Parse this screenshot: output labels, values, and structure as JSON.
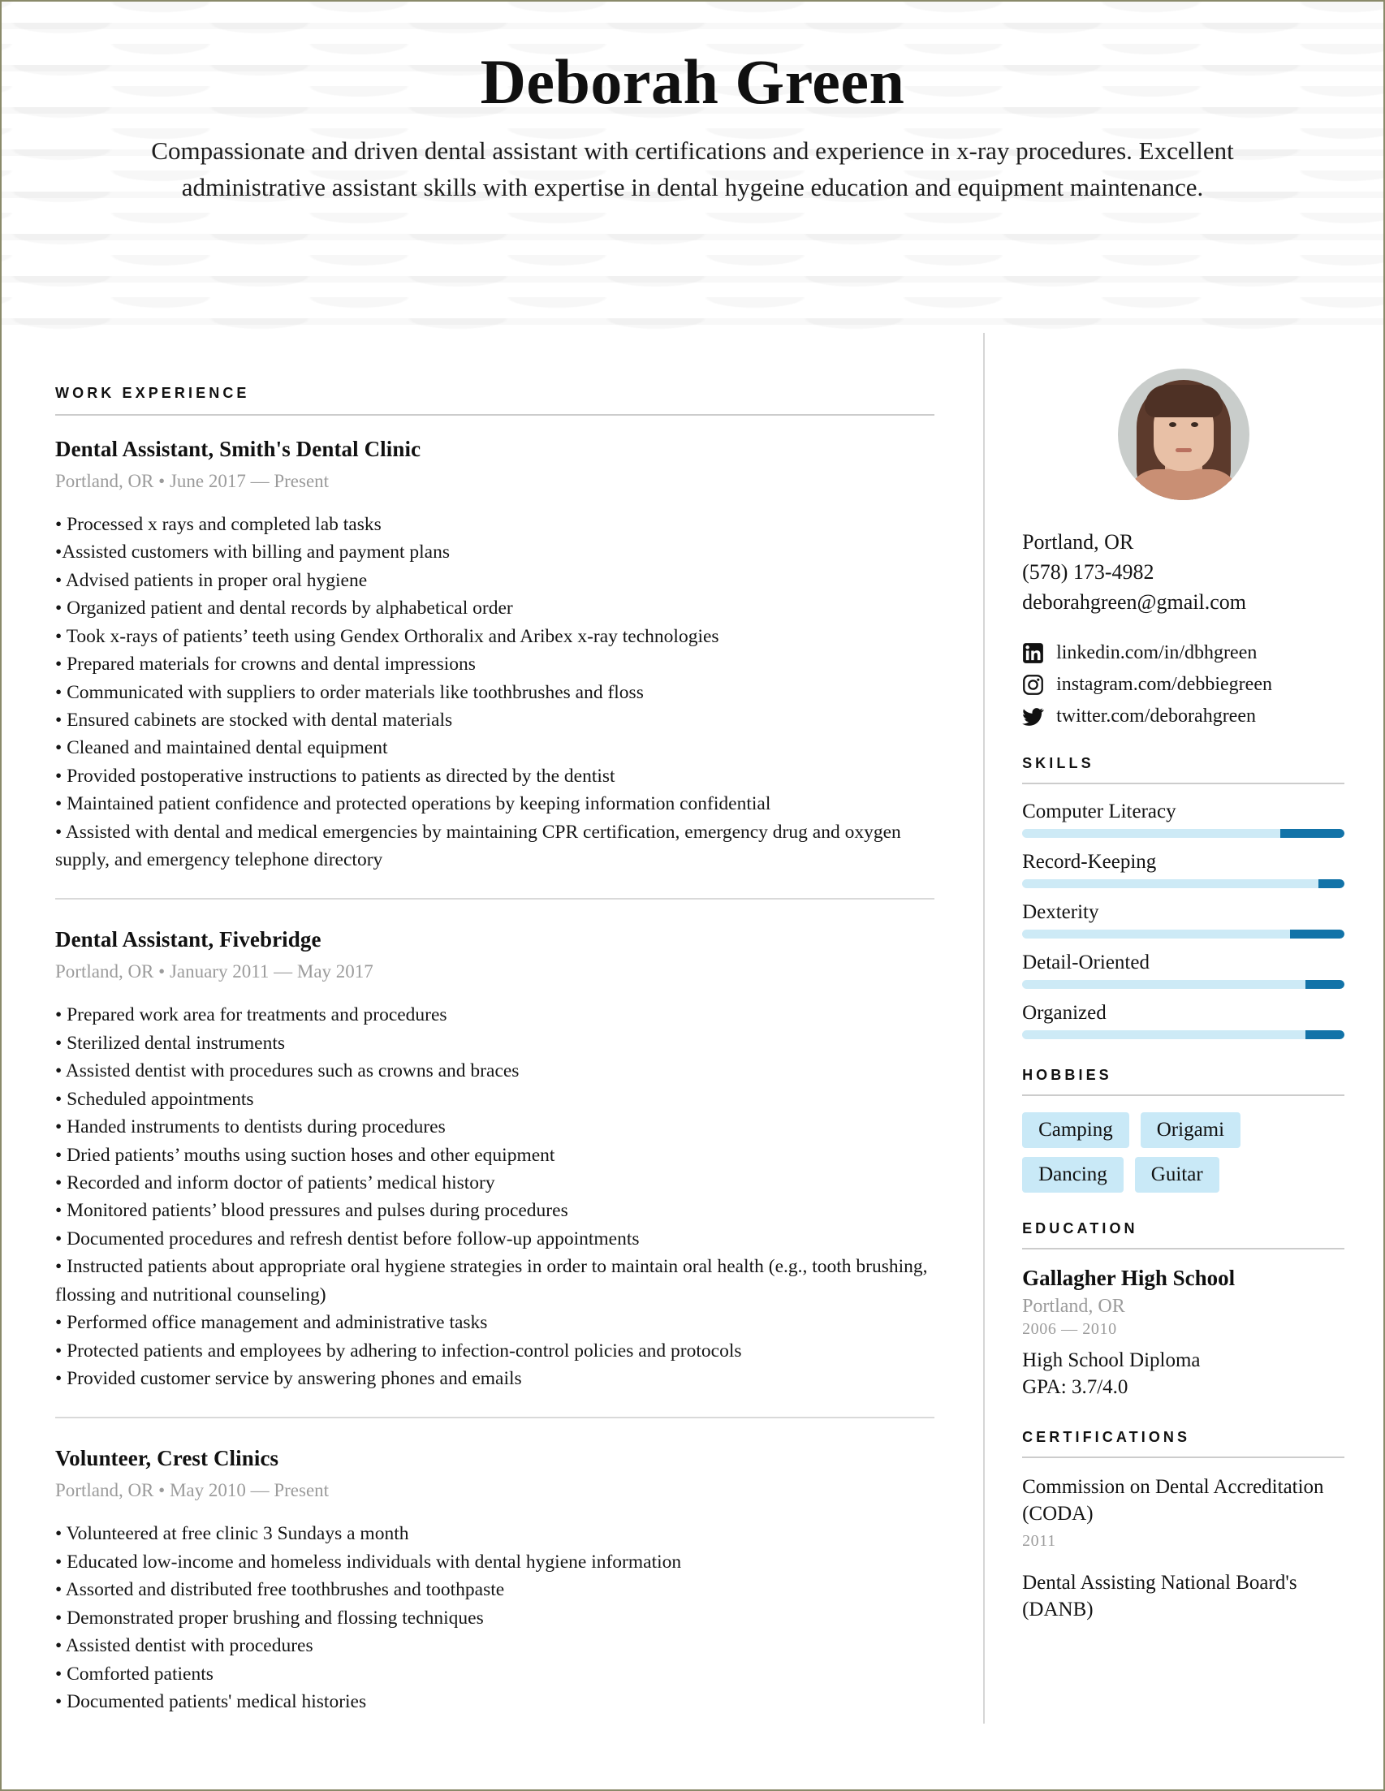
{
  "header": {
    "name": "Deborah Green",
    "summary": "Compassionate and driven dental assistant with certifications and experience in x-ray procedures. Excellent administrative assistant skills with expertise in dental hygeine education and equipment maintenance."
  },
  "work": {
    "heading": "WORK EXPERIENCE",
    "jobs": [
      {
        "title": "Dental Assistant, Smith's Dental Clinic",
        "meta": "Portland, OR • June 2017 — Present",
        "bullets": [
          "• Processed x rays and completed lab tasks",
          "•Assisted customers with billing and payment plans",
          "• Advised patients in proper oral hygiene",
          "• Organized patient and dental records by alphabetical order",
          "• Took x-rays of patients’ teeth using Gendex Orthoralix and Aribex x-ray technologies",
          "• Prepared materials for crowns and dental impressions",
          "• Communicated with suppliers to order materials like toothbrushes and floss",
          "• Ensured cabinets are stocked with dental materials",
          "• Cleaned and maintained dental equipment",
          "• Provided postoperative instructions to patients as directed by the dentist",
          "• Maintained patient confidence and protected operations by keeping information confidential",
          "• Assisted with dental and medical emergencies by maintaining CPR certification, emergency drug and oxygen supply, and emergency telephone directory"
        ]
      },
      {
        "title": "Dental Assistant, Fivebridge",
        "meta": "Portland, OR • January 2011 — May 2017",
        "bullets": [
          "• Prepared work area for treatments and procedures",
          "• Sterilized dental instruments",
          "• Assisted dentist with procedures such as crowns and braces",
          "• Scheduled appointments",
          "• Handed instruments to dentists during procedures",
          "• Dried patients’ mouths using suction hoses and other equipment",
          "• Recorded and inform doctor of patients’ medical history",
          "• Monitored patients’ blood pressures and pulses during procedures",
          "• Documented procedures and refresh dentist before follow-up appointments",
          "• Instructed patients about appropriate oral hygiene strategies in order to maintain oral health (e.g., tooth brushing, flossing and nutritional counseling)",
          "• Performed office management and administrative tasks",
          "• Protected patients and employees by adhering to infection-control policies and protocols",
          "• Provided customer service by answering phones and emails"
        ]
      },
      {
        "title": "Volunteer, Crest Clinics",
        "meta": "Portland, OR • May 2010 — Present",
        "bullets": [
          "• Volunteered at free clinic 3 Sundays a month",
          "• Educated low-income and homeless individuals with dental hygiene information",
          "• Assorted and distributed free toothbrushes and toothpaste",
          "• Demonstrated proper brushing and flossing techniques",
          "• Assisted dentist with procedures",
          "• Comforted patients",
          "• Documented patients' medical histories"
        ]
      }
    ]
  },
  "sidebar": {
    "avatar_alt": "profile-photo",
    "contact": {
      "location": "Portland, OR",
      "phone": "(578) 173-4982",
      "email": "deborahgreen@gmail.com"
    },
    "socials": [
      {
        "icon": "linkedin-icon",
        "text": "linkedin.com/in/dbhgreen"
      },
      {
        "icon": "instagram-icon",
        "text": "instagram.com/debbiegreen"
      },
      {
        "icon": "twitter-icon",
        "text": "twitter.com/deborahgreen"
      }
    ],
    "skills": {
      "heading": "SKILLS",
      "items": [
        {
          "name": "Computer Literacy",
          "level": 80
        },
        {
          "name": "Record-Keeping",
          "level": 92
        },
        {
          "name": "Dexterity",
          "level": 83
        },
        {
          "name": "Detail-Oriented",
          "level": 88
        },
        {
          "name": "Organized",
          "level": 88
        }
      ],
      "track_color": "#cdeaf6",
      "lead_color": "#1273a8"
    },
    "hobbies": {
      "heading": "HOBBIES",
      "items": [
        "Camping",
        "Origami",
        "Dancing",
        "Guitar"
      ],
      "pill_color": "#c9e9f7"
    },
    "education": {
      "heading": "EDUCATION",
      "school": "Gallagher High School",
      "location": "Portland, OR",
      "years": "2006 — 2010",
      "degree": "High School Diploma",
      "gpa": "GPA: 3.7/4.0"
    },
    "certifications": {
      "heading": "CERTIFICATIONS",
      "items": [
        {
          "name": "Commission on Dental Accreditation (CODA)",
          "year": "2011"
        },
        {
          "name": "Dental Assisting National Board's (DANB)",
          "year": ""
        }
      ]
    }
  }
}
